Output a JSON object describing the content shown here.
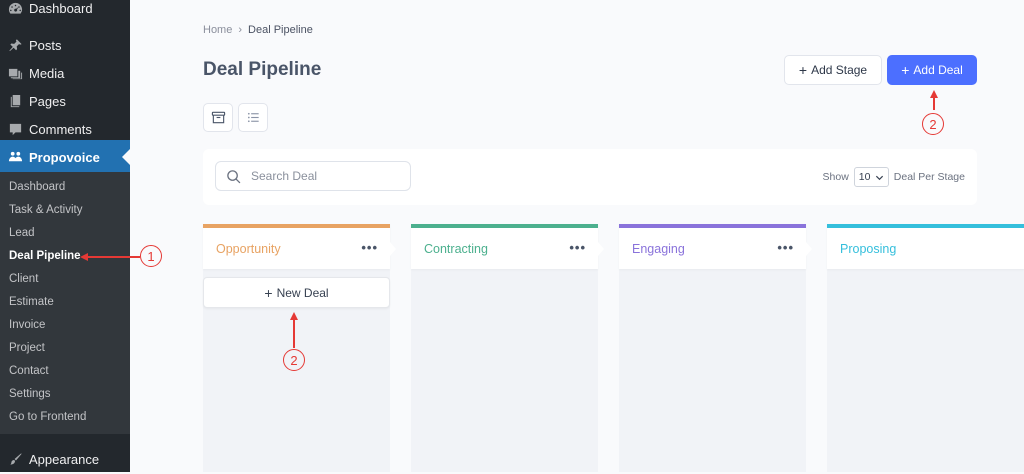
{
  "wp_menu": [
    {
      "name": "menu-dashboard",
      "icon": "dashboard-icon",
      "label": "Dashboard"
    },
    {
      "name": "menu-posts",
      "icon": "pin-icon",
      "label": "Posts"
    },
    {
      "name": "menu-media",
      "icon": "media-icon",
      "label": "Media"
    },
    {
      "name": "menu-pages",
      "icon": "pages-icon",
      "label": "Pages"
    },
    {
      "name": "menu-comments",
      "icon": "comment-icon",
      "label": "Comments"
    },
    {
      "name": "menu-propovoice",
      "icon": "propovoice-icon",
      "label": "Propovoice"
    },
    {
      "name": "menu-appearance",
      "icon": "brush-icon",
      "label": "Appearance"
    }
  ],
  "submenu": [
    "Dashboard",
    "Task & Activity",
    "Lead",
    "Deal Pipeline",
    "Client",
    "Estimate",
    "Invoice",
    "Project",
    "Contact",
    "Settings",
    "Go to Frontend"
  ],
  "submenu_current": "Deal Pipeline",
  "breadcrumb": {
    "home": "Home",
    "current": "Deal Pipeline"
  },
  "page_title": "Deal Pipeline",
  "toolbar": {
    "add_stage": "Add Stage",
    "add_deal": "Add Deal",
    "plus": "+"
  },
  "search": {
    "placeholder": "Search Deal"
  },
  "per_stage": {
    "show_label": "Show",
    "value": "10",
    "suffix": "Deal Per Stage"
  },
  "stages": [
    {
      "name": "Opportunity",
      "color": "#e8a363"
    },
    {
      "name": "Contracting",
      "color": "#4cb08e"
    },
    {
      "name": "Engaging",
      "color": "#8a73db"
    },
    {
      "name": "Proposing",
      "color": "#35bfdc"
    }
  ],
  "new_deal_label": "New Deal",
  "stage_menu_glyph": "•••",
  "annotations": [
    "1",
    "2",
    "2"
  ],
  "colors": {
    "sidebar": "#23282d",
    "submenu": "#32373c",
    "active": "#2271b1",
    "primary": "#4c6fff",
    "annotation": "#e53935"
  }
}
